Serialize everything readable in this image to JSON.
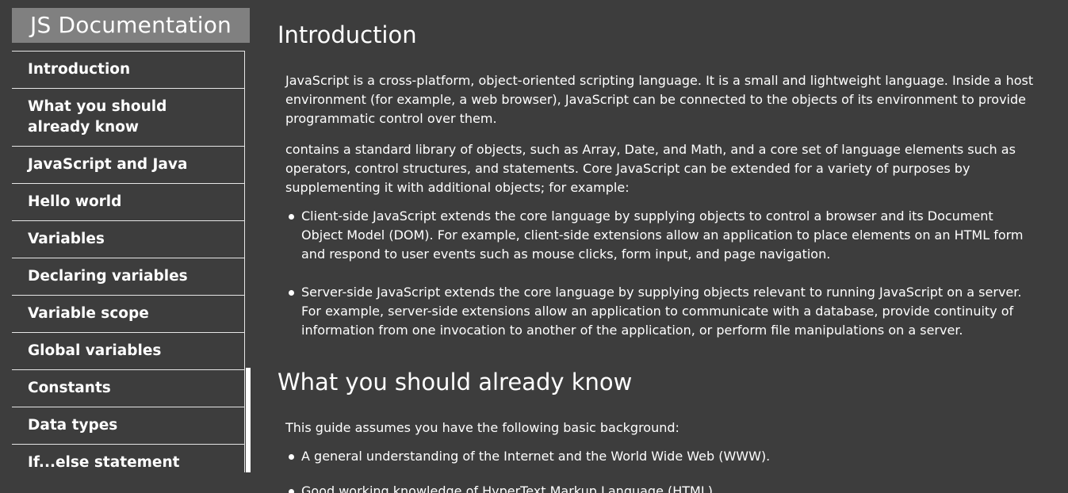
{
  "sidebar": {
    "header": "JS Documentation",
    "items": [
      {
        "label": "Introduction"
      },
      {
        "label": "What you should already know"
      },
      {
        "label": "JavaScript and Java"
      },
      {
        "label": "Hello world"
      },
      {
        "label": "Variables"
      },
      {
        "label": "Declaring variables"
      },
      {
        "label": "Variable scope"
      },
      {
        "label": "Global variables"
      },
      {
        "label": "Constants"
      },
      {
        "label": "Data types"
      },
      {
        "label": "If...else statement"
      }
    ]
  },
  "main": {
    "sections": [
      {
        "title": "Introduction",
        "paragraphs": [
          "JavaScript is a cross-platform, object-oriented scripting language. It is a small and lightweight language. Inside a host environment (for example, a web browser), JavaScript can be connected to the objects of its environment to provide programmatic control over them.",
          "contains a standard library of objects, such as Array, Date, and Math, and a core set of language elements such as operators, control structures, and statements. Core JavaScript can be extended for a variety of purposes by supplementing it with additional objects; for example:"
        ],
        "bullets": [
          "Client-side JavaScript extends the core language by supplying objects to control a browser and its Document Object Model (DOM). For example, client-side extensions allow an application to place elements on an HTML form and respond to user events such as mouse clicks, form input, and page navigation.",
          "Server-side JavaScript extends the core language by supplying objects relevant to running JavaScript on a server. For example, server-side extensions allow an application to communicate with a database, provide continuity of information from one invocation to another of the application, or perform file manipulations on a server."
        ]
      },
      {
        "title": "What you should already know",
        "paragraphs": [
          "This guide assumes you have the following basic background:"
        ],
        "bullets": [
          "A general understanding of the Internet and the World Wide Web (WWW).",
          "Good working knowledge of HyperText Markup Language (HTML)."
        ]
      }
    ]
  },
  "colors": {
    "background": "#3d3d3d",
    "sidebar_header_bg": "#808080",
    "text": "#ffffff",
    "divider": "#e6e6e6"
  }
}
